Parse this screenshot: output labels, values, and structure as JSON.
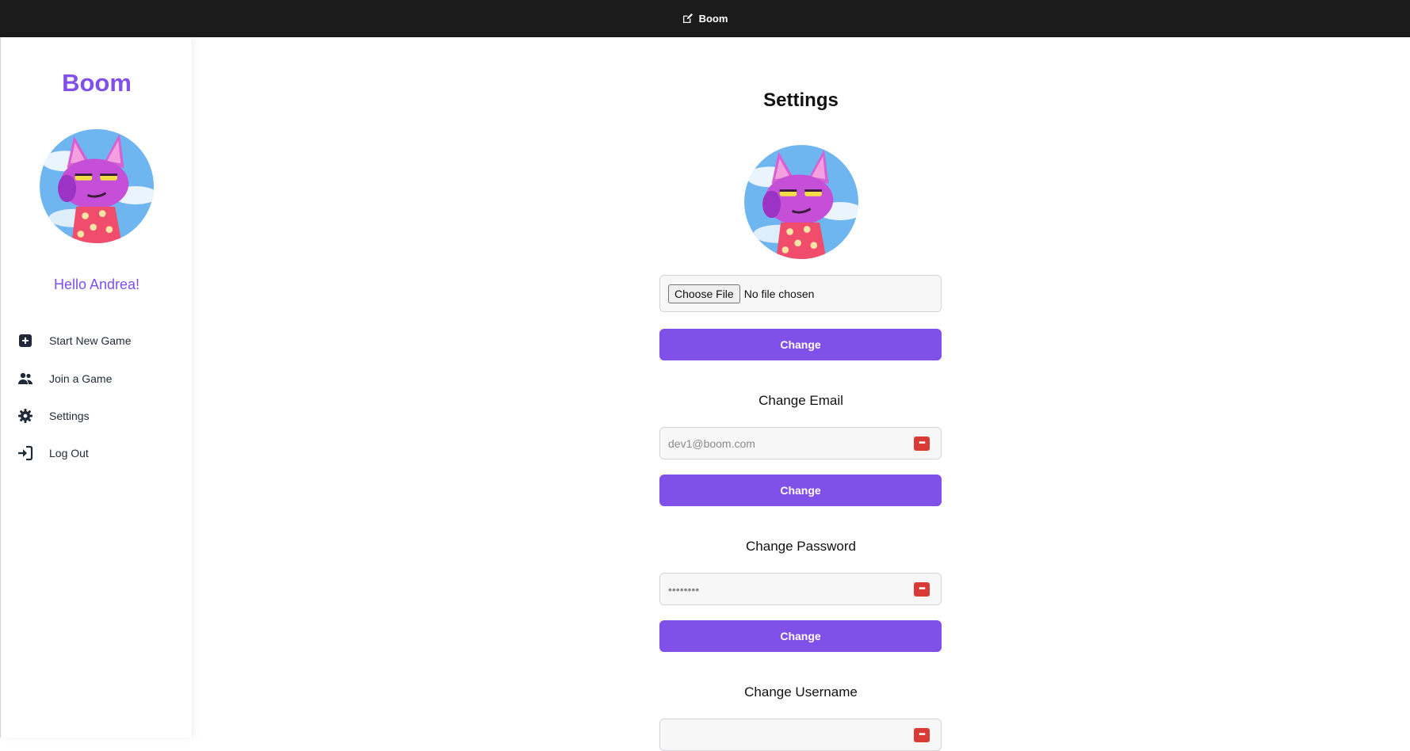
{
  "window": {
    "title": "Boom"
  },
  "sidebar": {
    "brand": "Boom",
    "greeting": "Hello Andrea!",
    "items": [
      {
        "label": "Start New Game",
        "icon": "plus-square-icon"
      },
      {
        "label": "Join a Game",
        "icon": "users-icon"
      },
      {
        "label": "Settings",
        "icon": "gear-icon"
      },
      {
        "label": "Log Out",
        "icon": "sign-in-icon"
      }
    ]
  },
  "main": {
    "title": "Settings",
    "avatar_upload": {
      "choose_label": "Choose File",
      "status": "No file chosen",
      "button": "Change"
    },
    "email": {
      "label": "Change Email",
      "placeholder": "dev1@boom.com",
      "button": "Change"
    },
    "password": {
      "label": "Change Password",
      "placeholder": "••••••••",
      "button": "Change"
    },
    "username": {
      "label": "Change Username"
    }
  },
  "colors": {
    "accent": "#8150e8",
    "titlebar": "#1b1b1c",
    "password_manager": "#d93a36"
  }
}
